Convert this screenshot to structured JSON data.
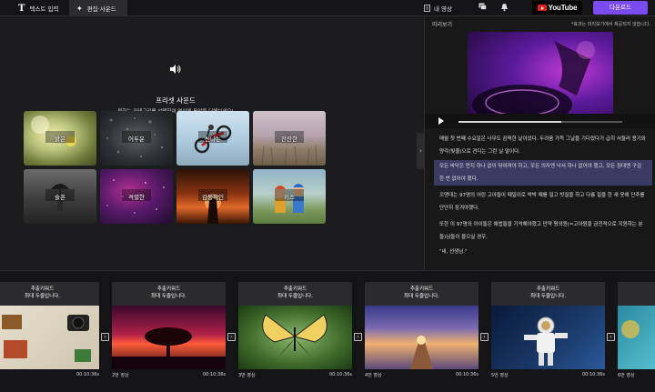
{
  "topbar": {
    "tab_text": "텍스트 입력",
    "tab_edit": "편집·사운드",
    "my_video": "내 영상",
    "youtube": "YouTube",
    "download": "다운로드"
  },
  "preset": {
    "title": "프리셋 사운드",
    "subtitle": "원하는 카테고리를 선택하여 영상에 음악을 더해보세요!",
    "moods": [
      "밝은",
      "어두운",
      "신나는",
      "잔잔한",
      "슬픈",
      "격렬한",
      "감동적인",
      "키즈"
    ]
  },
  "preview": {
    "title": "미리보기",
    "note": "*효과는 미리보기에서 제공되지 않습니다.",
    "progress": 0.63,
    "paragraphs": [
      "매월 첫 번째 수요일은 너무도 끔찍한 날이었다. 두려움 가득 그날을 기다렸다가 급히 서둘러 용기와 양각(빛줄)으로 견디는 그런 날 말이다.",
      "모든 바닥은 먼지 하나 없이 닦여져야 하고, 모든 의자엔 낙서 하나 없어야 했고, 모든 침대엔 구김 한 번 없어야 했다.",
      "꼬맹대는 97명의 어린 고아들이 때밀이로 박박 때를 밀고 빗질을 하고 다름 질을 한 새 옷에 단추를 단단히 잠겨야했다.",
      "또한 이 97명의 아이들은 예법들을 기억해야했고 만약 평의원(=고아원을 금전적으로 지원하는 분들)님들이 물으실 경우,",
      "\"네, 선생님.\""
    ]
  },
  "clips": [
    {
      "kw1": "추출키워드",
      "kw2": "최대 두줄입니다.",
      "name": "",
      "dur": "00:10:36s"
    },
    {
      "kw1": "추출키워드",
      "kw2": "최대 두줄입니다.",
      "name": "2번 영상",
      "dur": "00:10:36s"
    },
    {
      "kw1": "추출키워드",
      "kw2": "최대 두줄입니다.",
      "name": "3번 영상",
      "dur": "00:10:36s"
    },
    {
      "kw1": "추출키워드",
      "kw2": "최대 두줄입니다.",
      "name": "4번 영상",
      "dur": "00:10:36s"
    },
    {
      "kw1": "추출키워드",
      "kw2": "최대 두줄입니다.",
      "name": "5번 영상",
      "dur": "00:10:36s"
    },
    {
      "kw1": "",
      "kw2": "",
      "name": "6번 영상",
      "dur": ""
    }
  ],
  "colors": {
    "accent": "#7a4cf0",
    "highlight": "#3b3a63",
    "youtube_red": "#e62117"
  }
}
